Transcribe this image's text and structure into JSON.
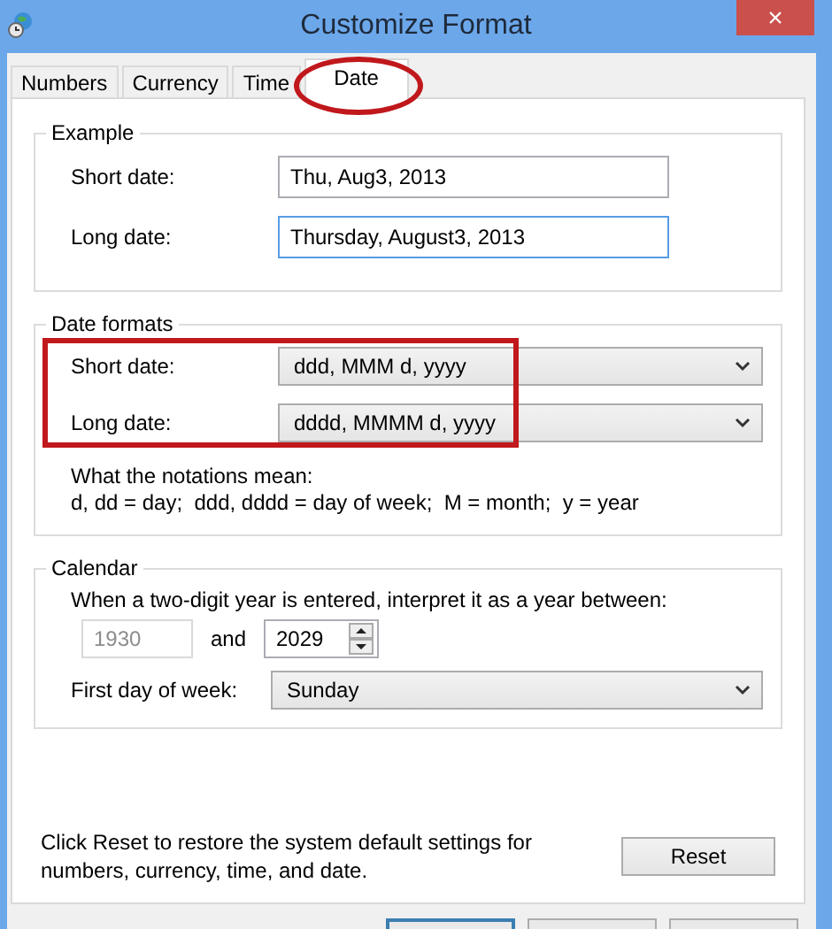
{
  "window": {
    "title": "Customize Format",
    "close": "×"
  },
  "tabs": [
    {
      "label": "Numbers",
      "selected": false,
      "highlighted": false
    },
    {
      "label": "Currency",
      "selected": false,
      "highlighted": false
    },
    {
      "label": "Time",
      "selected": false,
      "highlighted": false
    },
    {
      "label": "Date",
      "selected": true,
      "highlighted": true
    }
  ],
  "example": {
    "title": "Example",
    "rows": [
      {
        "label": "Short date:",
        "value": "Thu, Aug3, 2013",
        "focused": false
      },
      {
        "label": "Long date:",
        "value": "Thursday, August3, 2013",
        "focused": true
      }
    ]
  },
  "date_formats": {
    "title": "Date formats",
    "highlighted": true,
    "rows": [
      {
        "label": "Short date:",
        "value": "ddd, MMM d, yyyy"
      },
      {
        "label": "Long date:",
        "value": "dddd, MMMM d, yyyy"
      }
    ],
    "notes": [
      "What the notations mean:",
      "d, dd = day;  ddd, dddd = day of week;  M = month;  y = year"
    ]
  },
  "calendar": {
    "title": "Calendar",
    "prompt": "When a two-digit year is entered, interpret it as a year between:",
    "year_from": {
      "value": "1930",
      "disabled": true
    },
    "conjunction": "and",
    "year_to": {
      "value": "2029",
      "disabled": false
    },
    "first_day": {
      "label": "First day of week:",
      "value": "Sunday"
    }
  },
  "reset": {
    "text": "Click Reset to restore the system default settings for numbers, currency, time, and date.",
    "button": "Reset"
  },
  "footer_buttons": [
    {
      "default": true
    },
    {
      "default": false
    },
    {
      "default": false
    }
  ]
}
